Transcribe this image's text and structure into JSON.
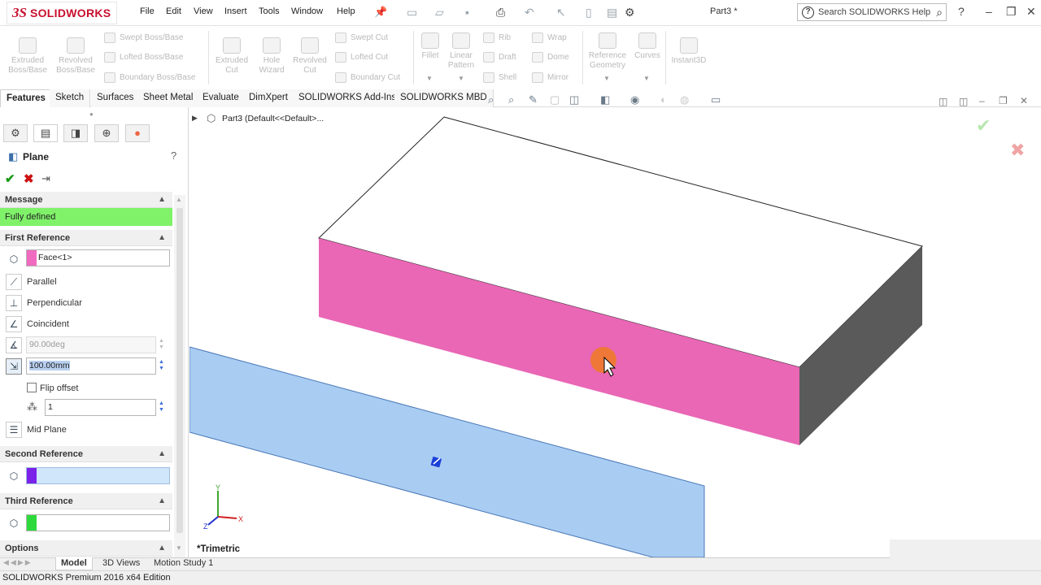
{
  "app": {
    "logo_prefix": "3S",
    "logo_text": "SOLIDWORKS",
    "document_title": "Part3 *"
  },
  "menu": [
    "File",
    "Edit",
    "View",
    "Insert",
    "Tools",
    "Window",
    "Help"
  ],
  "search": {
    "placeholder": "Search SOLIDWORKS Help"
  },
  "ribbon": {
    "extruded_boss": "Extruded Boss/Base",
    "revolved_boss": "Revolved Boss/Base",
    "swept_boss": "Swept Boss/Base",
    "lofted_boss": "Lofted Boss/Base",
    "boundary_boss": "Boundary Boss/Base",
    "extruded_cut": "Extruded Cut",
    "hole_wizard": "Hole Wizard",
    "revolved_cut": "Revolved Cut",
    "swept_cut": "Swept Cut",
    "lofted_cut": "Lofted Cut",
    "boundary_cut": "Boundary Cut",
    "fillet": "Fillet",
    "linear_pattern": "Linear Pattern",
    "rib": "Rib",
    "draft": "Draft",
    "shell": "Shell",
    "wrap": "Wrap",
    "dome": "Dome",
    "mirror": "Mirror",
    "reference_geometry": "Reference Geometry",
    "curves": "Curves",
    "instant3d": "Instant3D"
  },
  "command_tabs": [
    "Features",
    "Sketch",
    "Surfaces",
    "Sheet Metal",
    "Evaluate",
    "DimXpert",
    "SOLIDWORKS Add-Ins",
    "SOLIDWORKS MBD"
  ],
  "property_manager": {
    "title": "Plane",
    "help": "?",
    "message_header": "Message",
    "message": "Fully defined",
    "first_reference": {
      "header": "First Reference",
      "selection": "Face<1>",
      "options": [
        "Parallel",
        "Perpendicular",
        "Coincident"
      ],
      "angle": "90.00deg",
      "distance": "100.00mm",
      "flip_offset_label": "Flip offset",
      "flip_offset_checked": false,
      "instances": "1",
      "mid_plane": "Mid Plane"
    },
    "second_reference": {
      "header": "Second Reference",
      "selection": ""
    },
    "third_reference": {
      "header": "Third Reference",
      "selection": ""
    },
    "options_header": "Options"
  },
  "feature_tree": {
    "root": "Part3  (Default<<Default>..."
  },
  "viewport": {
    "view_label": "*Trimetric"
  },
  "bottom_tabs": [
    "Model",
    "3D Views",
    "Motion Study 1"
  ],
  "status": {
    "edition": "SOLIDWORKS Premium 2016 x64 Edition"
  },
  "colors": {
    "selected_face": "#e967b5",
    "preview_plane": "#a9cdf2",
    "message_bg": "#80f26a",
    "second_ref_swatch": "#7a22e8",
    "third_ref_swatch": "#2ed93c",
    "first_ref_swatch": "#f06ac0",
    "cursor_highlight": "#f07a2a"
  },
  "icons": [
    "search-icon",
    "help-icon",
    "minimize-icon",
    "restore-icon",
    "close-icon",
    "ok-checkmark-icon",
    "cancel-x-icon",
    "pushpin-icon"
  ]
}
